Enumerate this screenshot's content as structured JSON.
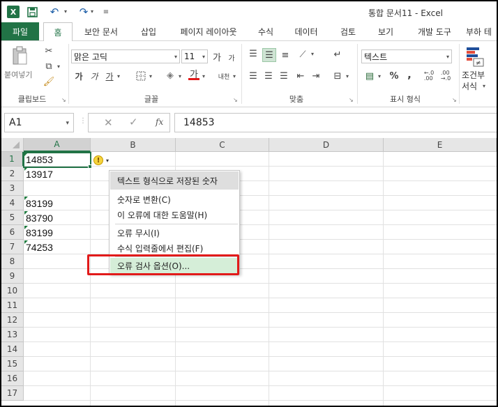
{
  "title_bar": {
    "title": "통합 문서11 - Excel",
    "app_logo": "X"
  },
  "tabs": {
    "file": "파일",
    "items": [
      "홈",
      "보안 문서",
      "삽입",
      "페이지 레이아웃",
      "수식",
      "데이터",
      "검토",
      "보기",
      "개발 도구",
      "부하 테"
    ],
    "active": "홈"
  },
  "ribbon": {
    "clipboard": {
      "paste_label": "붙여넣기",
      "group_label": "클립보드"
    },
    "font": {
      "font_name": "맑은 고딕",
      "font_size": "11",
      "bold": "가",
      "italic": "가",
      "underline": "가",
      "grow": "가",
      "shrink": "가",
      "phonetic": "내천",
      "font_color_letter": "가",
      "group_label": "글꼴",
      "font_color": "#e21a1a"
    },
    "alignment": {
      "group_label": "맞춤"
    },
    "number": {
      "format": "텍스트",
      "percent": "%",
      "comma": ",",
      "inc_dec": "←.0 .00",
      "dec_dec": ".00 →.0",
      "group_label": "표시 형식"
    },
    "styles": {
      "conditional_label_1": "조건부",
      "conditional_label_2": "서식"
    }
  },
  "formula_bar": {
    "name_box": "A1",
    "fx": "fx",
    "value": "14853"
  },
  "grid": {
    "columns": [
      "A",
      "B",
      "C",
      "D",
      "E"
    ],
    "rows": [
      "1",
      "2",
      "3",
      "4",
      "5",
      "6",
      "7",
      "8",
      "9",
      "10",
      "11",
      "12",
      "13",
      "14",
      "15",
      "16",
      "17"
    ],
    "cells": [
      {
        "row": 1,
        "value": "14853"
      },
      {
        "row": 2,
        "value": "13917"
      },
      {
        "row": 4,
        "value": "83199"
      },
      {
        "row": 5,
        "value": "83790"
      },
      {
        "row": 6,
        "value": "83199"
      },
      {
        "row": 7,
        "value": "74253"
      }
    ],
    "selected_cell": "A1"
  },
  "error_menu": {
    "header": "텍스트 형식으로 저장된 숫자",
    "items": [
      "숫자로 변환(C)",
      "이 오류에 대한 도움말(H)",
      "오류 무시(I)",
      "수식 입력줄에서 편집(F)",
      "오류 검사 옵션(O)..."
    ],
    "highlighted": "오류 검사 옵션(O)...",
    "highlight_color": "#e21a1a"
  },
  "colors": {
    "accent": "#217346",
    "error_icon": "#f5d33c"
  }
}
